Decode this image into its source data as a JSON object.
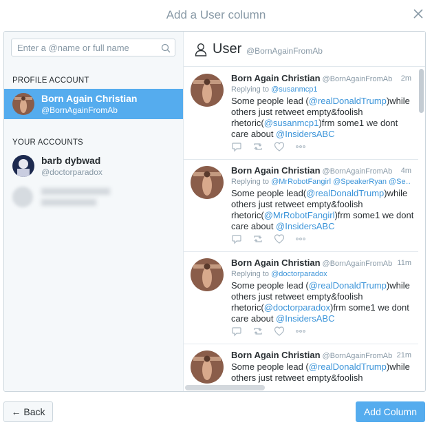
{
  "dialog": {
    "title": "Add a User column"
  },
  "search": {
    "placeholder": "Enter a @name or full name"
  },
  "profile_section": {
    "label": "PROFILE ACCOUNT",
    "account": {
      "name": "Born Again Christian",
      "handle": "@BornAgainFromAb"
    }
  },
  "your_accounts": {
    "label": "YOUR ACCOUNTS",
    "accounts": [
      {
        "name": "barb dybwad",
        "handle": "@doctorparadox"
      }
    ]
  },
  "column": {
    "title": "User",
    "handle": "@BornAgainFromAb"
  },
  "tweets": [
    {
      "name": "Born Again Christian",
      "handle": "@BornAgainFromAb",
      "time": "2m",
      "reply_prefix": "Replying to ",
      "reply_to": "@susanmcp1",
      "t1": "Some people lead (",
      "l1": "@realDonaldTrump",
      "t2": ")while others just retweet empty&foolish rhetoric(",
      "l2": "@susanmcp1",
      "t3": ")frm some1 we dont care about ",
      "l3": "@InsidersABC"
    },
    {
      "name": "Born Again Christian",
      "handle": "@BornAgainFromAb",
      "time": "4m",
      "reply_prefix": "Replying to ",
      "reply_to": "@MrRobotFangirl @SpeakerRyan @Se…",
      "t1": "Some people lead(",
      "l1": "@realDonaldTrump",
      "t2": ")while others just retweet empty&foolish rhetoric(",
      "l2": "@MrRobotFangirl",
      "t3": ")frm some1 we dont care about ",
      "l3": "@InsidersABC"
    },
    {
      "name": "Born Again Christian",
      "handle": "@BornAgainFromAb",
      "time": "11m",
      "reply_prefix": "Replying to ",
      "reply_to": "@doctorparadox",
      "t1": "Some people lead (",
      "l1": "@realDonaldTrump",
      "t2": ")while others just retweet empty&foolish rhetoric(",
      "l2": "@doctorparadox",
      "t3": ")frm some1 we dont care about ",
      "l3": "@InsidersABC"
    },
    {
      "name": "Born Again Christian",
      "handle": "@BornAgainFromAb",
      "time": "21m",
      "t1": "Some people lead (",
      "l1": "@realDonaldTrump",
      "t2": ")while others just retweet empty&foolish"
    }
  ],
  "buttons": {
    "back": "← Back",
    "add": "Add Column"
  },
  "colors": {
    "accent": "#55acee",
    "link": "#3b94d9",
    "muted": "#8899a6"
  }
}
